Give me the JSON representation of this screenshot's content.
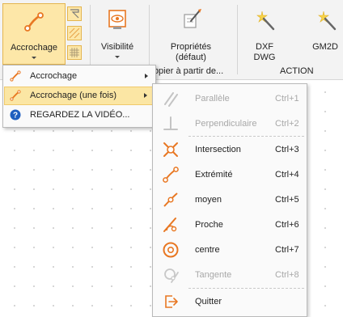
{
  "ribbon": {
    "accrochage_label": "Accrochage",
    "visibilite_label": "Visibilité",
    "proprietes_line1": "Propriétés",
    "proprietes_line2": "(défaut)",
    "copier_label": "Copier à partir de...",
    "dxf_line1": "DXF",
    "dxf_line2": "DWG",
    "gm2d_label": "GM2D",
    "action_group": "ACTION"
  },
  "dropdown": {
    "items": [
      {
        "label": "Accrochage",
        "icon": "snap-icon",
        "has_submenu": true
      },
      {
        "label": "Accrochage (une fois)",
        "icon": "snap-once-icon",
        "has_submenu": true
      },
      {
        "label": "REGARDEZ LA VIDÉO...",
        "icon": "help-icon",
        "has_submenu": false
      }
    ]
  },
  "submenu": {
    "items": [
      {
        "label": "Parallèle",
        "shortcut": "Ctrl+1",
        "icon": "parallel-icon",
        "enabled": false
      },
      {
        "label": "Perpendiculaire",
        "shortcut": "Ctrl+2",
        "icon": "perpendicular-icon",
        "enabled": false
      },
      {
        "label": "Intersection",
        "shortcut": "Ctrl+3",
        "icon": "intersection-icon",
        "enabled": true
      },
      {
        "label": "Extrémité",
        "shortcut": "Ctrl+4",
        "icon": "endpoint-icon",
        "enabled": true
      },
      {
        "label": "moyen",
        "shortcut": "Ctrl+5",
        "icon": "midpoint-icon",
        "enabled": true
      },
      {
        "label": "Proche",
        "shortcut": "Ctrl+6",
        "icon": "nearest-icon",
        "enabled": true
      },
      {
        "label": "centre",
        "shortcut": "Ctrl+7",
        "icon": "center-icon",
        "enabled": true
      },
      {
        "label": "Tangente",
        "shortcut": "Ctrl+8",
        "icon": "tangent-icon",
        "enabled": false
      },
      {
        "label": "Quitter",
        "shortcut": "",
        "icon": "exit-icon",
        "enabled": true
      }
    ]
  },
  "colors": {
    "accent_orange": "#e87722",
    "highlight": "#fbe6a4",
    "disabled_text": "#a8a8a8"
  }
}
